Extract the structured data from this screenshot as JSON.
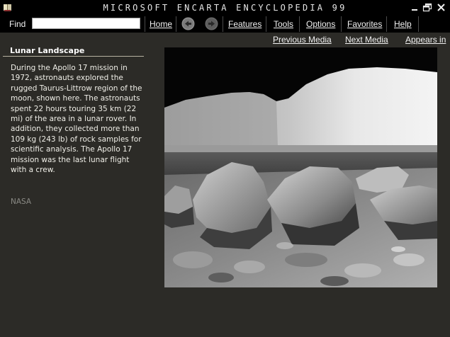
{
  "window": {
    "title": "MICROSOFT ENCARTA ENCYCLOPEDIA 99"
  },
  "menubar": {
    "find_label": "Find",
    "find_value": "",
    "home_label": "Home",
    "features_label": "Features",
    "tools_label": "Tools",
    "options_label": "Options",
    "favorites_label": "Favorites",
    "help_label": "Help",
    "back_icon": "back-arrow-icon",
    "forward_icon": "forward-arrow-icon"
  },
  "subnav": {
    "previous_media": "Previous Media",
    "next_media": "Next Media",
    "appears_in": "Appears in"
  },
  "caption": {
    "title": "Lunar Landscape",
    "body": "During the Apollo 17 mission in 1972, astronauts explored the rugged Taurus-Littrow region of the moon, shown here. The astronauts spent 22 hours touring 35 km (22 mi) of the area in a lunar rover. In addition, they collected more than 109 kg (243 lb) of rock samples for scientific analysis. The Apollo 17 mission was the last lunar flight with a crew.",
    "credit": "NASA"
  },
  "colors": {
    "background": "#2c2b27",
    "bar": "#000000",
    "text": "#f0efe8",
    "credit": "#8a8a85"
  }
}
